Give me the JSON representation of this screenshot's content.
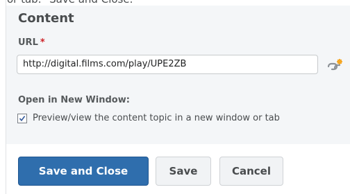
{
  "clipped_top_text": "or tab.\" Save and Close.",
  "section": {
    "heading": "Content"
  },
  "url_field": {
    "label": "URL",
    "required_marker": "*",
    "value": "http://digital.films.com/play/UPE2ZB",
    "picker_icon": "quicklink-picker-icon"
  },
  "open_new_window": {
    "label": "Open in New Window:",
    "checkbox_checked": true,
    "checkbox_text": "Preview/view the content topic in a new window or tab"
  },
  "buttons": {
    "save_and_close": "Save and Close",
    "save": "Save",
    "cancel": "Cancel"
  },
  "colors": {
    "primary_button": "#2f6ead",
    "required_marker": "#cd2026",
    "panel_background": "#f4f6f8"
  }
}
